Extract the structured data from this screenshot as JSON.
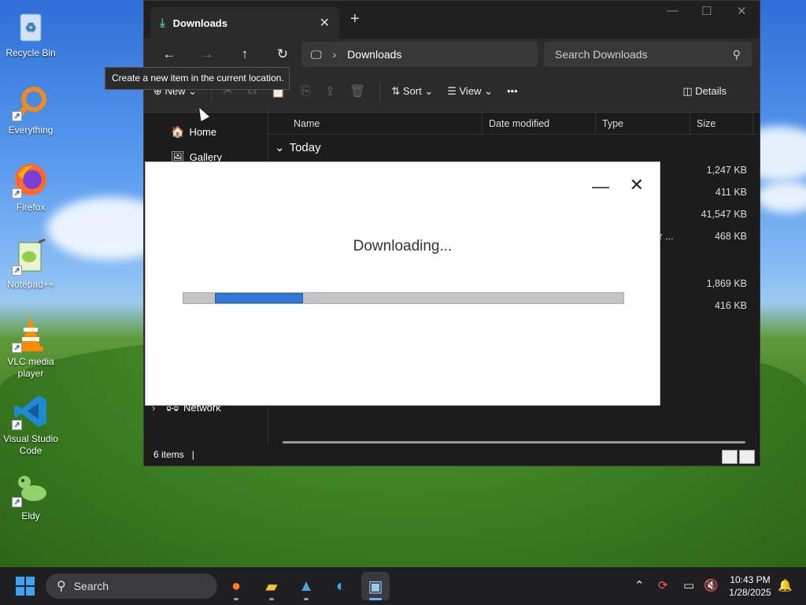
{
  "desktop": {
    "icons": [
      {
        "label": "Recycle Bin",
        "icon": "recycle-bin-icon"
      },
      {
        "label": "Everything",
        "icon": "everything-search-icon"
      },
      {
        "label": "Firefox",
        "icon": "firefox-icon"
      },
      {
        "label": "Notepad++",
        "icon": "notepadpp-icon"
      },
      {
        "label": "VLC media player",
        "icon": "vlc-icon"
      },
      {
        "label": "Visual Studio Code",
        "icon": "vscode-icon"
      },
      {
        "label": "Eldy",
        "icon": "eldy-icon"
      }
    ]
  },
  "explorer": {
    "tab_title": "Downloads",
    "address": "Downloads",
    "search_placeholder": "Search Downloads",
    "commands": {
      "new": "New",
      "sort": "Sort",
      "view": "View",
      "more": "•••",
      "details": "Details"
    },
    "tooltip": "Create a new item in the current location.",
    "sidebar": [
      {
        "label": "Home",
        "icon": "home-icon"
      },
      {
        "label": "Gallery",
        "icon": "gallery-icon"
      },
      {
        "label": "Network",
        "icon": "network-icon"
      }
    ],
    "columns": [
      "Name",
      "Date modified",
      "Type",
      "Size"
    ],
    "group": "Today",
    "rows": [
      {
        "type": "",
        "size": "1,247 KB"
      },
      {
        "type": "",
        "size": "411 KB"
      },
      {
        "type": "",
        "size": "41,547 KB"
      },
      {
        "type": "ller ...",
        "size": "468 KB"
      },
      {
        "type": "",
        "size": "1,869 KB"
      },
      {
        "type": "",
        "size": "416 KB"
      }
    ],
    "status": "6 items"
  },
  "dialog": {
    "message": "Downloading...",
    "progress_fraction": 0.2
  },
  "taskbar": {
    "search_label": "Search",
    "time": "10:43 PM",
    "date": "1/28/2025"
  },
  "colors": {
    "accent": "#2f7ad8",
    "explorer_bg": "#1c1c1c",
    "taskbar_bg": "#1f1f22"
  }
}
